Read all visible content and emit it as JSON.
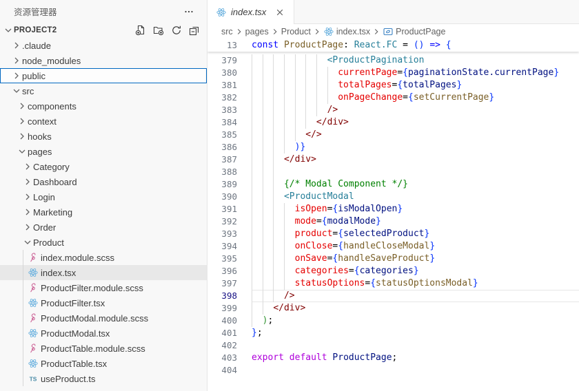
{
  "colors": {
    "focus_border": "#0067C0",
    "selection_bg": "#E8E8E8",
    "react_icon": "#6CB2DF",
    "sass_icon": "#CD6799",
    "ts_icon": "#498BA7",
    "symbol_icon": "#3B82C4"
  },
  "explorer": {
    "title": "资源管理器",
    "more_icon": "more-icon",
    "project": {
      "name": "PROJECT2",
      "actions": [
        {
          "name": "new-file-icon",
          "label": "New File"
        },
        {
          "name": "new-folder-icon",
          "label": "New Folder"
        },
        {
          "name": "refresh-icon",
          "label": "Refresh Explorer"
        },
        {
          "name": "collapse-all-icon",
          "label": "Collapse Folders"
        }
      ]
    },
    "items": [
      {
        "label": ".claude",
        "level": 0,
        "kind": "folder",
        "expanded": false
      },
      {
        "label": "node_modules",
        "level": 0,
        "kind": "folder",
        "expanded": false
      },
      {
        "label": "public",
        "level": 0,
        "kind": "folder",
        "expanded": false,
        "focused": true
      },
      {
        "label": "src",
        "level": 0,
        "kind": "folder",
        "expanded": true
      },
      {
        "label": "components",
        "level": 1,
        "kind": "folder",
        "expanded": false
      },
      {
        "label": "context",
        "level": 1,
        "kind": "folder",
        "expanded": false
      },
      {
        "label": "hooks",
        "level": 1,
        "kind": "folder",
        "expanded": false
      },
      {
        "label": "pages",
        "level": 1,
        "kind": "folder",
        "expanded": true
      },
      {
        "label": "Category",
        "level": 2,
        "kind": "folder",
        "expanded": false
      },
      {
        "label": "Dashboard",
        "level": 2,
        "kind": "folder",
        "expanded": false
      },
      {
        "label": "Login",
        "level": 2,
        "kind": "folder",
        "expanded": false
      },
      {
        "label": "Marketing",
        "level": 2,
        "kind": "folder",
        "expanded": false
      },
      {
        "label": "Order",
        "level": 2,
        "kind": "folder",
        "expanded": false
      },
      {
        "label": "Product",
        "level": 2,
        "kind": "folder",
        "expanded": true
      },
      {
        "label": "index.module.scss",
        "level": 3,
        "kind": "file",
        "icon": "sass-icon"
      },
      {
        "label": "index.tsx",
        "level": 3,
        "kind": "file",
        "icon": "react-icon",
        "selected": true
      },
      {
        "label": "ProductFilter.module.scss",
        "level": 3,
        "kind": "file",
        "icon": "sass-icon"
      },
      {
        "label": "ProductFilter.tsx",
        "level": 3,
        "kind": "file",
        "icon": "react-icon"
      },
      {
        "label": "ProductModal.module.scss",
        "level": 3,
        "kind": "file",
        "icon": "sass-icon"
      },
      {
        "label": "ProductModal.tsx",
        "level": 3,
        "kind": "file",
        "icon": "react-icon"
      },
      {
        "label": "ProductTable.module.scss",
        "level": 3,
        "kind": "file",
        "icon": "sass-icon"
      },
      {
        "label": "ProductTable.tsx",
        "level": 3,
        "kind": "file",
        "icon": "react-icon"
      },
      {
        "label": "useProduct.ts",
        "level": 3,
        "kind": "file",
        "icon": "ts-icon"
      }
    ]
  },
  "editor": {
    "tab": {
      "label": "index.tsx",
      "icon": "react-icon",
      "close_icon": "close-icon",
      "preview": true
    },
    "breadcrumbs": [
      {
        "label": "src"
      },
      {
        "label": "pages"
      },
      {
        "label": "Product"
      },
      {
        "label": "index.tsx",
        "icon": "react-icon"
      },
      {
        "label": "ProductPage",
        "icon": "symbol-variable-icon"
      }
    ],
    "sticky_line": {
      "n": 13,
      "ind": 0,
      "tk": [
        [
          "const ",
          "kw"
        ],
        [
          "ProductPage",
          "fn"
        ],
        [
          ": ",
          "pl"
        ],
        [
          "React.FC",
          "type"
        ],
        [
          " = ",
          "pl"
        ],
        [
          "()",
          "br"
        ],
        [
          " ",
          "pl"
        ],
        [
          "=>",
          "kw"
        ],
        [
          " {",
          "br"
        ]
      ]
    },
    "lines": [
      {
        "n": 379,
        "ind": 14,
        "tk": [
          [
            "<ProductPagination",
            "type"
          ]
        ]
      },
      {
        "n": 380,
        "ind": 16,
        "tk": [
          [
            "currentPage",
            "attr"
          ],
          [
            "=",
            "pl"
          ],
          [
            "{",
            "br"
          ],
          [
            "paginationState.currentPage",
            "var"
          ],
          [
            "}",
            "br"
          ]
        ]
      },
      {
        "n": 381,
        "ind": 16,
        "tk": [
          [
            "totalPages",
            "attr"
          ],
          [
            "=",
            "pl"
          ],
          [
            "{",
            "br"
          ],
          [
            "totalPages",
            "var"
          ],
          [
            "}",
            "br"
          ]
        ]
      },
      {
        "n": 382,
        "ind": 16,
        "tk": [
          [
            "onPageChange",
            "attr"
          ],
          [
            "=",
            "pl"
          ],
          [
            "{",
            "br"
          ],
          [
            "setCurrentPage",
            "fn"
          ],
          [
            "}",
            "br"
          ]
        ]
      },
      {
        "n": 383,
        "ind": 14,
        "tk": [
          [
            "/>",
            "tag"
          ]
        ]
      },
      {
        "n": 384,
        "ind": 12,
        "tk": [
          [
            "</div>",
            "tag"
          ]
        ]
      },
      {
        "n": 385,
        "ind": 10,
        "tk": [
          [
            "</>",
            "tag"
          ]
        ]
      },
      {
        "n": 386,
        "ind": 8,
        "tk": [
          [
            ")}",
            "br"
          ]
        ]
      },
      {
        "n": 387,
        "ind": 6,
        "tk": [
          [
            "</div>",
            "tag"
          ]
        ]
      },
      {
        "n": 388,
        "ind": 6,
        "tk": []
      },
      {
        "n": 389,
        "ind": 6,
        "tk": [
          [
            "{/* Modal Component */}",
            "cm"
          ]
        ]
      },
      {
        "n": 390,
        "ind": 6,
        "tk": [
          [
            "<ProductModal",
            "type"
          ]
        ]
      },
      {
        "n": 391,
        "ind": 8,
        "tk": [
          [
            "isOpen",
            "attr"
          ],
          [
            "=",
            "pl"
          ],
          [
            "{",
            "br"
          ],
          [
            "isModalOpen",
            "var"
          ],
          [
            "}",
            "br"
          ]
        ]
      },
      {
        "n": 392,
        "ind": 8,
        "tk": [
          [
            "mode",
            "attr"
          ],
          [
            "=",
            "pl"
          ],
          [
            "{",
            "br"
          ],
          [
            "modalMode",
            "var"
          ],
          [
            "}",
            "br"
          ]
        ]
      },
      {
        "n": 393,
        "ind": 8,
        "tk": [
          [
            "product",
            "attr"
          ],
          [
            "=",
            "pl"
          ],
          [
            "{",
            "br"
          ],
          [
            "selectedProduct",
            "var"
          ],
          [
            "}",
            "br"
          ]
        ]
      },
      {
        "n": 394,
        "ind": 8,
        "tk": [
          [
            "onClose",
            "attr"
          ],
          [
            "=",
            "pl"
          ],
          [
            "{",
            "br"
          ],
          [
            "handleCloseModal",
            "fn"
          ],
          [
            "}",
            "br"
          ]
        ]
      },
      {
        "n": 395,
        "ind": 8,
        "tk": [
          [
            "onSave",
            "attr"
          ],
          [
            "=",
            "pl"
          ],
          [
            "{",
            "br"
          ],
          [
            "handleSaveProduct",
            "fn"
          ],
          [
            "}",
            "br"
          ]
        ]
      },
      {
        "n": 396,
        "ind": 8,
        "tk": [
          [
            "categories",
            "attr"
          ],
          [
            "=",
            "pl"
          ],
          [
            "{",
            "br"
          ],
          [
            "categories",
            "var"
          ],
          [
            "}",
            "br"
          ]
        ]
      },
      {
        "n": 397,
        "ind": 8,
        "tk": [
          [
            "statusOptions",
            "attr"
          ],
          [
            "=",
            "pl"
          ],
          [
            "{",
            "br"
          ],
          [
            "statusOptionsModal",
            "fn"
          ],
          [
            "}",
            "br"
          ]
        ]
      },
      {
        "n": 398,
        "ind": 6,
        "tk": [
          [
            "/>",
            "tag"
          ]
        ],
        "current": true
      },
      {
        "n": 399,
        "ind": 4,
        "tk": [
          [
            "</div>",
            "tag"
          ]
        ]
      },
      {
        "n": 400,
        "ind": 2,
        "tk": [
          [
            ")",
            "brg"
          ],
          [
            ";",
            "pl"
          ]
        ]
      },
      {
        "n": 401,
        "ind": 0,
        "tk": [
          [
            "}",
            "br"
          ],
          [
            ";",
            "pl"
          ]
        ]
      },
      {
        "n": 402,
        "ind": 0,
        "tk": []
      },
      {
        "n": 403,
        "ind": 0,
        "tk": [
          [
            "export",
            "kw2"
          ],
          [
            " ",
            "pl"
          ],
          [
            "default",
            "kw2"
          ],
          [
            " ",
            "pl"
          ],
          [
            "ProductPage",
            "var"
          ],
          [
            ";",
            "pl"
          ]
        ]
      },
      {
        "n": 404,
        "ind": 0,
        "tk": []
      }
    ]
  }
}
